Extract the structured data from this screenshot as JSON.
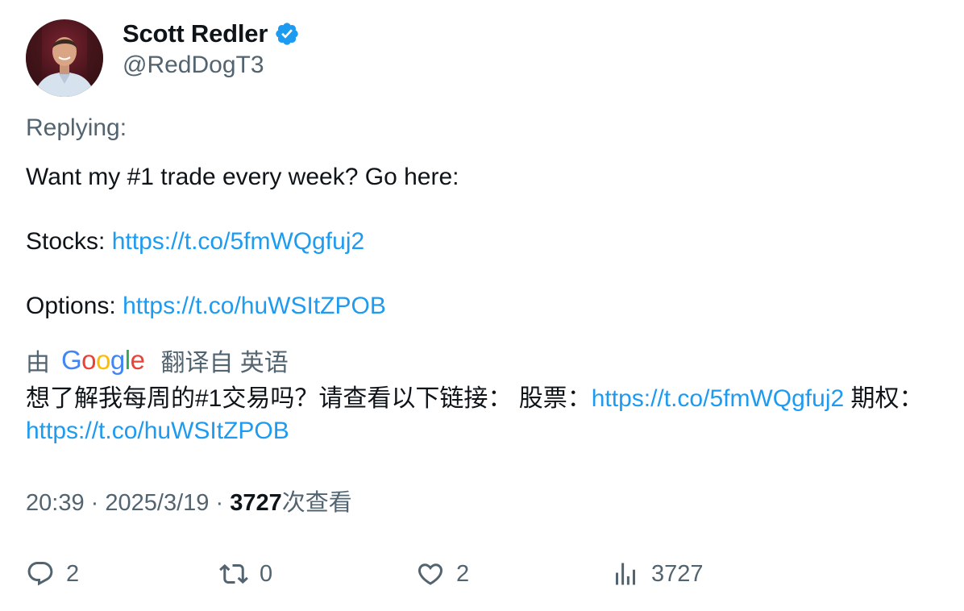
{
  "author": {
    "display_name": "Scott Redler",
    "handle": "@RedDogT3",
    "verified_icon": "verified-badge-icon",
    "verified_color": "#1d9bf0"
  },
  "replying_label": "Replying:",
  "tweet": {
    "line1": "Want my #1 trade every week? Go here:",
    "stocks_label": "Stocks:",
    "stocks_link": "https://t.co/5fmWQgfuj2",
    "options_label": "Options:",
    "options_link": "https://t.co/huWSItZPOB"
  },
  "translation": {
    "prefix": "由",
    "provider": "Google",
    "suffix": "翻译自 英语",
    "text_part1": "想了解我每周的#1交易吗？请查看以下链接： 股票：",
    "link1": "https://t.co/5fmWQgfuj2",
    "text_part2": "期权：",
    "link2": "https://t.co/huWSItZPOB"
  },
  "meta": {
    "time": "20:39",
    "separator": "·",
    "date": "2025/3/19",
    "views": "3727",
    "views_label": "次查看"
  },
  "actions": {
    "replies": "2",
    "reposts": "0",
    "likes": "2",
    "views": "3727"
  },
  "colors": {
    "link": "#1d9bf0",
    "muted": "#536471",
    "text": "#0f1419"
  }
}
